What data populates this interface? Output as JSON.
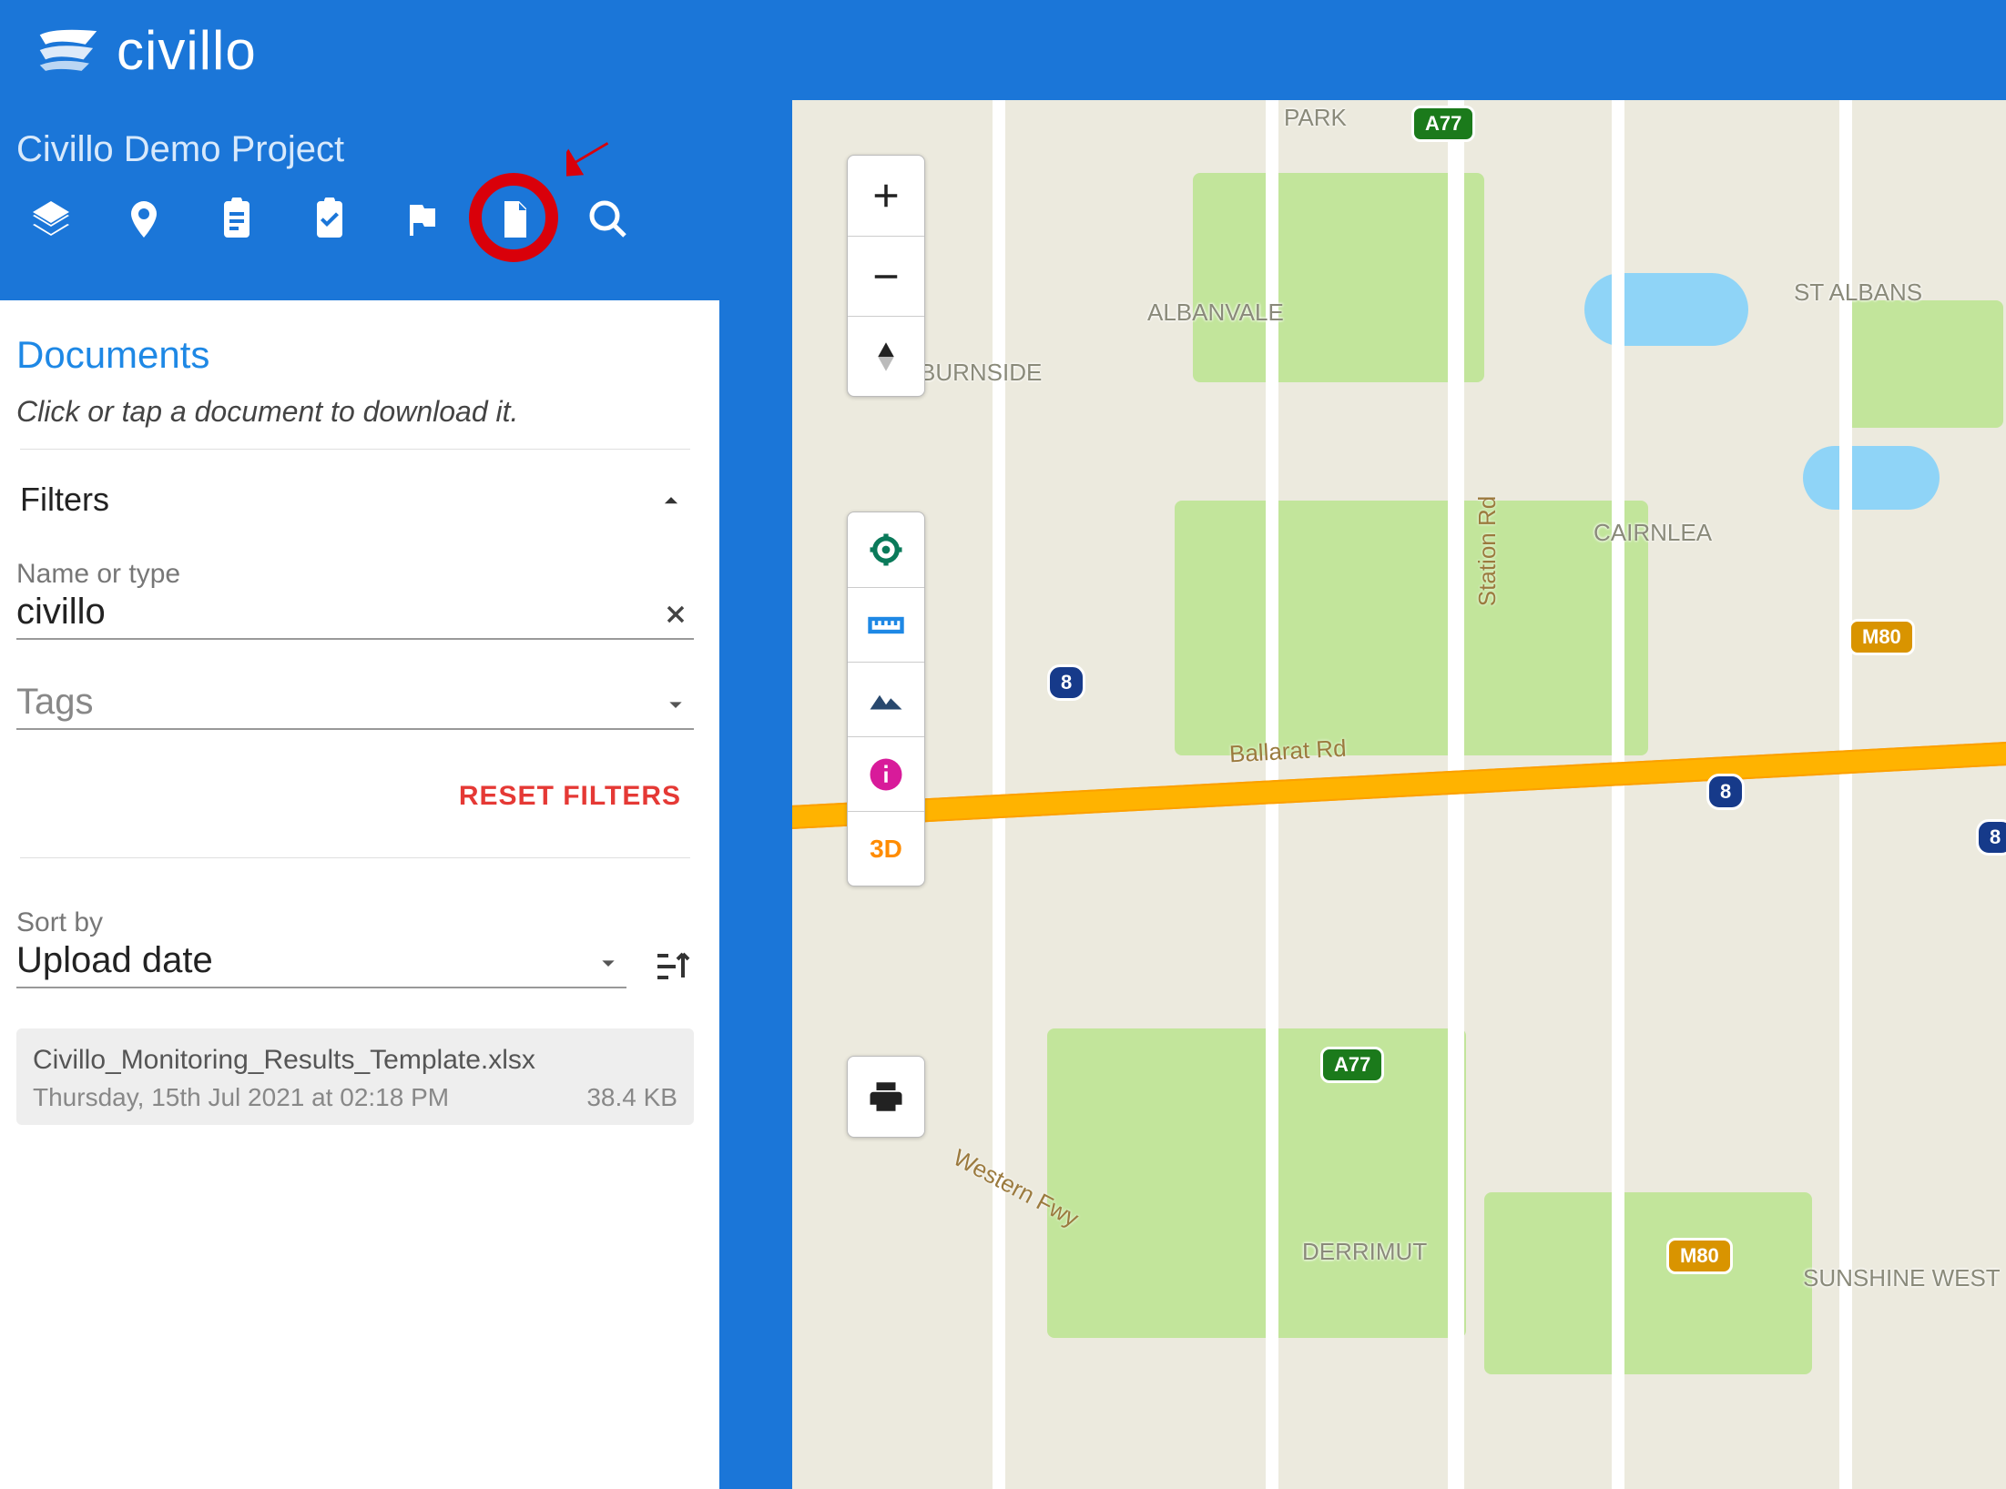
{
  "brand": {
    "name": "civillo"
  },
  "project": {
    "title": "Civillo Demo Project"
  },
  "panel": {
    "title": "Documents",
    "subtitle": "Click or tap a document to download it.",
    "filters": {
      "heading": "Filters",
      "name_label": "Name or type",
      "name_value": "civillo",
      "tags_placeholder": "Tags",
      "reset_label": "RESET FILTERS"
    },
    "sort": {
      "label": "Sort by",
      "value": "Upload date"
    },
    "documents": [
      {
        "name": "Civillo_Monitoring_Results_Template.xlsx",
        "date": "Thursday, 15th Jul 2021 at 02:18 PM",
        "size": "38.4 KB"
      }
    ]
  },
  "map": {
    "labels": {
      "park": "PARK",
      "albanvale": "ALBANVALE",
      "stalbans": "ST ALBANS",
      "burnside": "BURNSIDE",
      "cairnlea": "CAIRNLEA",
      "derrimut": "DERRIMUT",
      "sunshine": "SUNSHINE WEST"
    },
    "roads": {
      "ballarat": "Ballarat Rd",
      "western": "Western Fwy",
      "station": "Station Rd"
    },
    "shields": {
      "a77": "A77",
      "m80": "M80",
      "r8": "8"
    },
    "tools3d": "3D"
  }
}
